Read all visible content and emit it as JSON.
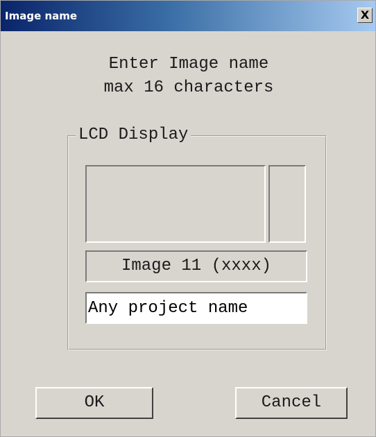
{
  "window": {
    "title": "Image name",
    "close_glyph": "X"
  },
  "prompt": {
    "line1": "Enter Image name",
    "line2": "max 16 characters"
  },
  "lcd_group": {
    "legend": "LCD Display",
    "image_label": "Image 11 (xxxx)"
  },
  "name_field": {
    "value": "Any project name",
    "max_length": 16
  },
  "buttons": {
    "ok": "OK",
    "cancel": "Cancel"
  },
  "colors": {
    "titlebar_start": "#0a246a",
    "titlebar_end": "#a6caf0",
    "dialog_bg": "#d8d5cf",
    "input_bg": "#ffffff"
  }
}
